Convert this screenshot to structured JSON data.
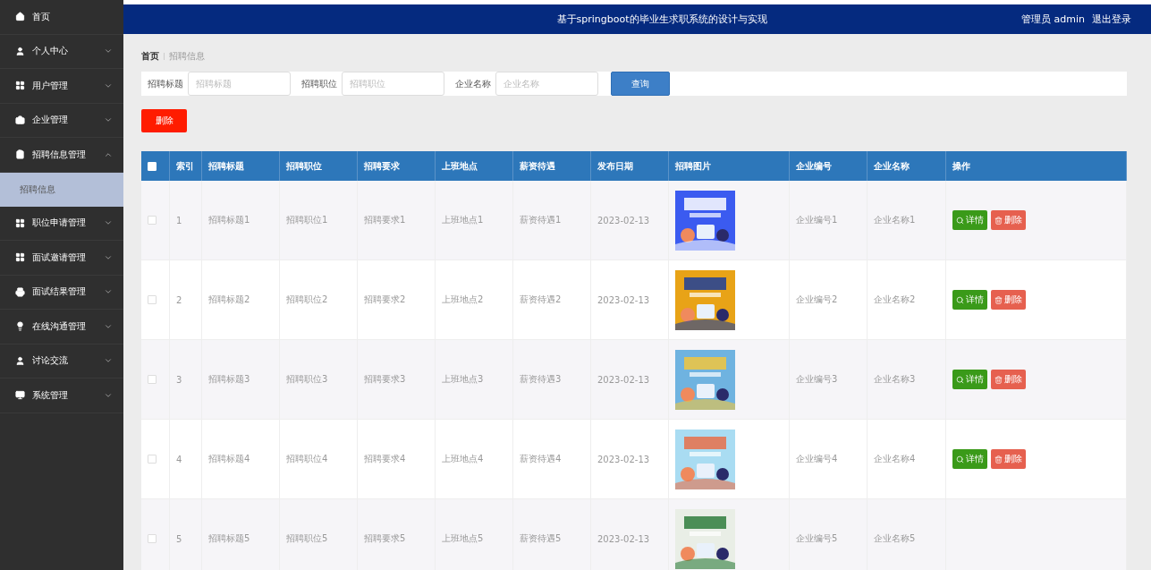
{
  "sidebar": {
    "items": [
      {
        "kind": "link",
        "label": "首页"
      },
      {
        "kind": "menu",
        "label": "个人中心",
        "expanded": false
      },
      {
        "kind": "menu",
        "label": "用户管理",
        "expanded": false
      },
      {
        "kind": "menu",
        "label": "企业管理",
        "expanded": false
      },
      {
        "kind": "menu",
        "label": "招聘信息管理",
        "expanded": true,
        "children": [
          {
            "label": "招聘信息",
            "selected": true
          }
        ]
      },
      {
        "kind": "menu",
        "label": "职位申请管理",
        "expanded": false
      },
      {
        "kind": "menu",
        "label": "面试邀请管理",
        "expanded": false
      },
      {
        "kind": "menu",
        "label": "面试结果管理",
        "expanded": false
      },
      {
        "kind": "menu",
        "label": "在线沟通管理",
        "expanded": false
      },
      {
        "kind": "menu",
        "label": "讨论交流",
        "expanded": false
      },
      {
        "kind": "menu",
        "label": "系统管理",
        "expanded": false
      }
    ]
  },
  "header": {
    "title": "基于springboot的毕业生求职系统的设计与实现",
    "user": "管理员 admin",
    "logout": "退出登录"
  },
  "breadcrumb": [
    "首页",
    "招聘信息"
  ],
  "search": {
    "fields": [
      {
        "label": "招聘标题",
        "placeholder": "招聘标题"
      },
      {
        "label": "招聘职位",
        "placeholder": "招聘职位"
      },
      {
        "label": "企业名称",
        "placeholder": "企业名称"
      }
    ],
    "button": "查询"
  },
  "delete_button": "删除",
  "table": {
    "all_checked": false,
    "columns": [
      "索引",
      "招聘标题",
      "招聘职位",
      "招聘要求",
      "上班地点",
      "薪资待遇",
      "发布日期",
      "招聘图片",
      "企业编号",
      "企业名称",
      "操作"
    ],
    "rows": [
      {
        "checked": false,
        "cells": [
          "1",
          "招聘标题1",
          "招聘职位1",
          "招聘要求1",
          "上班地点1",
          "薪资待遇1",
          "2023-02-13"
        ],
        "picture": {
          "kind": "picture"
        },
        "company": [
          "企业编号1",
          "企业名称1"
        ],
        "actions": [
          "详情",
          "删除"
        ]
      },
      {
        "checked": false,
        "cells": [
          "2",
          "招聘标题2",
          "招聘职位2",
          "招聘要求2",
          "上班地点2",
          "薪资待遇2",
          "2023-02-13"
        ],
        "picture": {
          "kind": "picture"
        },
        "company": [
          "企业编号2",
          "企业名称2"
        ],
        "actions": [
          "详情",
          "删除"
        ]
      },
      {
        "checked": false,
        "cells": [
          "3",
          "招聘标题3",
          "招聘职位3",
          "招聘要求3",
          "上班地点3",
          "薪资待遇3",
          "2023-02-13"
        ],
        "picture": {
          "kind": "picture"
        },
        "company": [
          "企业编号3",
          "企业名称3"
        ],
        "actions": [
          "详情",
          "删除"
        ]
      },
      {
        "checked": false,
        "cells": [
          "4",
          "招聘标题4",
          "招聘职位4",
          "招聘要求4",
          "上班地点4",
          "薪资待遇4",
          "2023-02-13"
        ],
        "picture": {
          "kind": "picture"
        },
        "company": [
          "企业编号4",
          "企业名称4"
        ],
        "actions": [
          "详情",
          "删除"
        ]
      },
      {
        "checked": false,
        "cells": [
          "5",
          "招聘标题5",
          "招聘职位5",
          "招聘要求5",
          "上班地点5",
          "薪资待遇5",
          "2023-02-13"
        ],
        "picture": {
          "kind": "picture"
        },
        "company": [
          "企业编号5",
          "企业名称5"
        ]
      }
    ]
  }
}
